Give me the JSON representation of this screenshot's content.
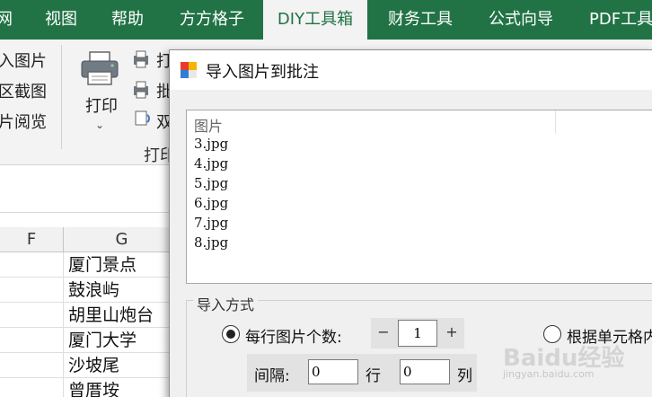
{
  "ribbon": {
    "tabs": [
      "网",
      "视图",
      "帮助",
      "方方格子",
      "DIY工具箱",
      "财务工具",
      "公式向导",
      "PDF工具"
    ],
    "active_tab": "DIY工具箱",
    "left_items": [
      "入图片",
      "区截图",
      "片阅览"
    ],
    "print_label": "打印",
    "print_items": [
      "打",
      "批",
      "双"
    ],
    "group_label": "打印"
  },
  "sheet": {
    "columns": [
      "F",
      "G"
    ],
    "rows": [
      "厦门景点",
      "鼓浪屿",
      "胡里山炮台",
      "厦门大学",
      "沙坡尾",
      "曾厝垵"
    ]
  },
  "dialog": {
    "title": "导入图片到批注",
    "list_header": "图片",
    "files": [
      "3.jpg",
      "4.jpg",
      "5.jpg",
      "6.jpg",
      "7.jpg",
      "8.jpg"
    ],
    "import_mode_label": "导入方式",
    "option_per_row": "每行图片个数:",
    "per_row_value": "1",
    "minus": "−",
    "plus": "+",
    "option_by_cell": "根据单元格内",
    "gap_label": "间隔:",
    "gap_row_value": "0",
    "gap_row_unit": "行",
    "gap_col_value": "0",
    "gap_col_unit": "列"
  },
  "watermark": {
    "text": "Baidu经验",
    "sub": "jingyan.baidu.com"
  },
  "colors": {
    "ribbon_green": "#217346",
    "dialog_bg": "#f0f0f0"
  }
}
